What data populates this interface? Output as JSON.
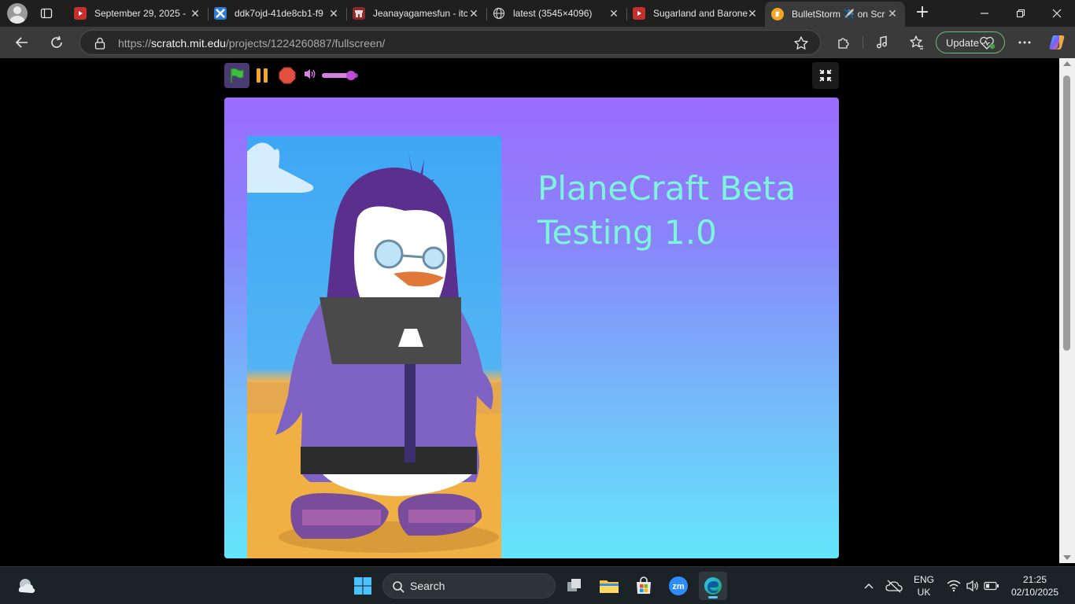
{
  "browser": {
    "tabs": [
      {
        "title": "September 29, 2025 -",
        "favicon": "youtube-icon",
        "favicon_color": "#c4302b"
      },
      {
        "title": "ddk7ojd-41de8cb1-f9",
        "favicon": "deviantart-icon",
        "favicon_color": "#2f7bd8"
      },
      {
        "title": "Jeanayagamesfun - itc",
        "favicon": "itchio-icon",
        "favicon_color": "#8a2a2a"
      },
      {
        "title": "latest (3545×4096)",
        "favicon": "globe-icon",
        "favicon_color": "#cfcfcf"
      },
      {
        "title": "Sugarland and Barone",
        "favicon": "youtube-icon",
        "favicon_color": "#c4302b"
      },
      {
        "title": "BulletStorm ✈️ on Scr",
        "favicon": "scratch-icon",
        "favicon_color": "#f5a623",
        "active": true
      }
    ],
    "address": {
      "scheme": "https://",
      "host": "scratch.mit.edu",
      "path": "/projects/1224260887/fullscreen/"
    },
    "update_label": "Update"
  },
  "player": {
    "volume_level": 0.8,
    "stage_title": "PlaneCraft Beta Testing 1.0",
    "colors": {
      "stage_top": "#9b6cff",
      "stage_bottom": "#63e6fb",
      "title_text": "#7df5d8",
      "flag": "#3fbf3f",
      "pause": "#f5a623",
      "stop": "#e0503c"
    }
  },
  "taskbar": {
    "search_label": "Search",
    "language": "ENG",
    "region": "UK",
    "time": "21:25",
    "date": "02/10/2025"
  }
}
